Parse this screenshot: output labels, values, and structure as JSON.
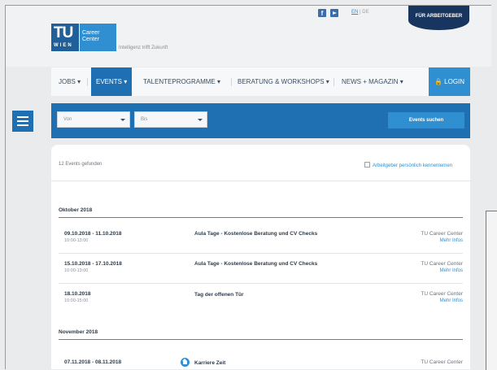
{
  "header": {
    "logo_tu": "TU",
    "logo_wien": "WIEN",
    "logo_cc_1": "Career",
    "logo_cc_2": "Center",
    "tagline": "Intelligenz trifft Zukunft",
    "lang_en": "EN",
    "lang_sep": " | ",
    "lang_de": "DE",
    "employer_label": "FÜR ARBEITGEBER",
    "social": [
      "facebook-icon",
      "youtube-icon"
    ]
  },
  "nav": {
    "items": [
      {
        "label": "JOBS ▾"
      },
      {
        "label": "EVENTS ▾"
      },
      {
        "label": "TALENTEPROGRAMME ▾"
      },
      {
        "label": "BERATUNG & WORKSHOPS ▾"
      },
      {
        "label": "NEWS + MAGAZIN ▾"
      }
    ],
    "login_label": "LOGIN"
  },
  "filter": {
    "from_label": "Von",
    "to_label": "Bis",
    "search_label": "Events suchen"
  },
  "results": {
    "count_text": "12 Events gefunden",
    "contact_text": "Arbeitgeber persönlich kennenlernen"
  },
  "months": [
    {
      "label": "Oktober 2018",
      "events": [
        {
          "date": "09.10.2018 - 11.10.2018",
          "time": "10:00-13:00",
          "title": "Aula Tage - Kostenlose Beratung und CV Checks",
          "org": "TU Career Center",
          "more": "Mehr Infos"
        },
        {
          "date": "15.10.2018 - 17.10.2018",
          "time": "10:00-13:00",
          "title": "Aula Tage - Kostenlose Beratung und CV Checks",
          "org": "TU Career Center",
          "more": "Mehr Infos"
        },
        {
          "date": "18.10.2018",
          "time": "10:00-15:00",
          "title": "Tag der offenen Tür",
          "org": "TU Career Center",
          "more": "Mehr Infos"
        }
      ]
    },
    {
      "label": "November 2018",
      "events": [
        {
          "date": "07.11.2018 - 08.11.2018",
          "time": "",
          "title": "Karriere Zeit",
          "org": "TU Career Center",
          "more": ""
        }
      ]
    }
  ],
  "colors": {
    "primary": "#1f6fb3",
    "accent": "#2f8fd0",
    "dark": "#17355f"
  }
}
